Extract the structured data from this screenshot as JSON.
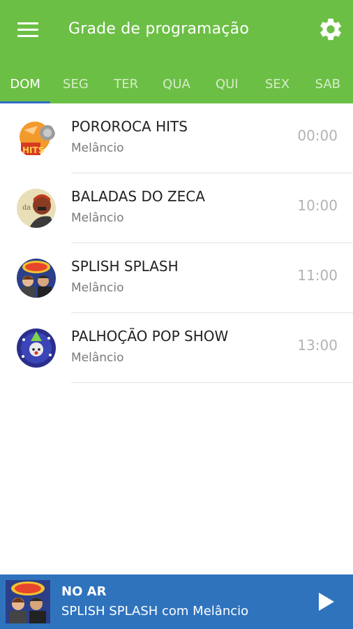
{
  "header": {
    "title": "Grade de programação",
    "icons": {
      "menu": "menu-icon",
      "settings": "gear-icon"
    },
    "color": "#6cbf45"
  },
  "tabs": [
    {
      "label": "DOM",
      "active": true
    },
    {
      "label": "SEG"
    },
    {
      "label": "TER"
    },
    {
      "label": "QUA"
    },
    {
      "label": "QUI"
    },
    {
      "label": "SEX"
    },
    {
      "label": "SAB"
    }
  ],
  "schedule": [
    {
      "title": "POROROCA HITS",
      "host": "Melâncio",
      "time": "00:00",
      "icon": "pororoca-hits-logo"
    },
    {
      "title": "BALADAS DO ZECA",
      "host": "Melâncio",
      "time": "10:00",
      "icon": "baladas-do-zeca-logo"
    },
    {
      "title": "SPLISH SPLASH",
      "host": "Melâncio",
      "time": "11:00",
      "icon": "splish-splash-logo"
    },
    {
      "title": "PALHOÇÃO POP SHOW",
      "host": "Melâncio",
      "time": "13:00",
      "icon": "palhocao-pop-show-logo"
    }
  ],
  "player": {
    "label": "NO AR",
    "now_playing": "SPLISH SPLASH com Melâncio",
    "icon": "play-icon",
    "color": "#2f73bd"
  },
  "colors": {
    "accent": "#6cbf45",
    "tab_indicator": "#2f6fc9",
    "player": "#2f73bd"
  }
}
